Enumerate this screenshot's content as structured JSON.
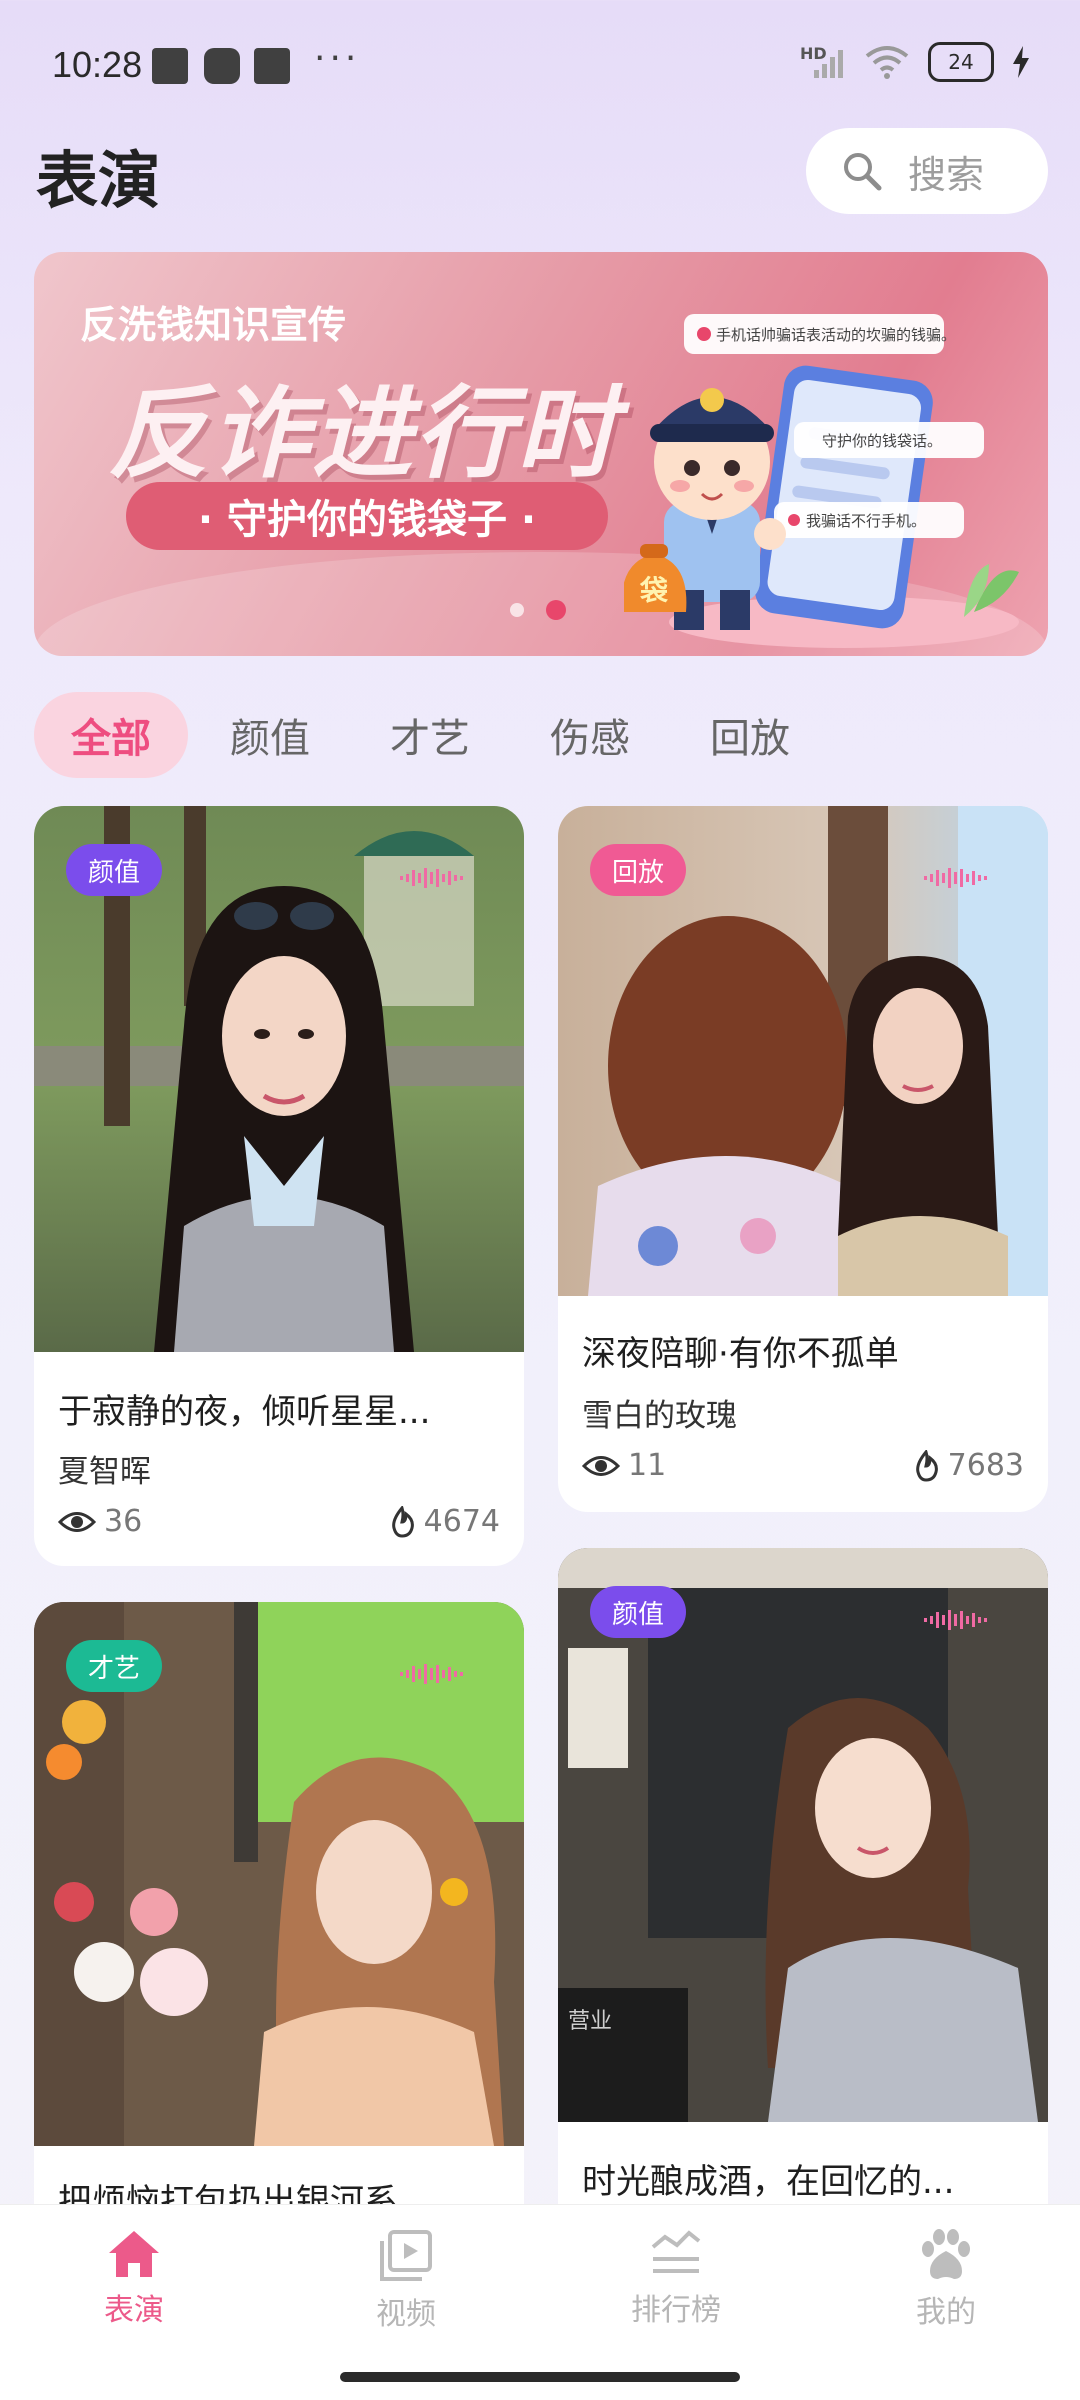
{
  "status_bar": {
    "time": "10:28",
    "dots": "···",
    "network": "HD",
    "battery": "24"
  },
  "header": {
    "title": "表演",
    "search_label": "搜索"
  },
  "banner": {
    "subtitle": "反洗钱知识宣传",
    "headline": "反诈进行时",
    "slogan": "· 守护你的钱袋子 ·",
    "bubbles": [
      "手机话帅骗话表活动的坎骗的钱骗。",
      "守护你的钱袋话。",
      "我骗话不行手机。"
    ],
    "bag_text": "袋",
    "page_index": 2,
    "page_count": 2
  },
  "tabs": [
    {
      "label": "全部",
      "active": true
    },
    {
      "label": "颜值",
      "active": false
    },
    {
      "label": "才艺",
      "active": false
    },
    {
      "label": "伤感",
      "active": false
    },
    {
      "label": "回放",
      "active": false
    }
  ],
  "cards": [
    {
      "badge": "颜值",
      "badge_color": "#7b4dec",
      "title": "于寂静的夜，倾听星星...",
      "author": "夏智晖",
      "views": "36",
      "heat": "4674"
    },
    {
      "badge": "回放",
      "badge_color": "#f05a94",
      "title": "深夜陪聊·有你不孤单",
      "author": "雪白的玫瑰",
      "views": "11",
      "heat": "7683"
    },
    {
      "badge": "才艺",
      "badge_color": "#1cba94",
      "title": "把烦恼打包扔出银河系",
      "author": "",
      "views": "",
      "heat": ""
    },
    {
      "badge": "颜值",
      "badge_color": "#7b4dec",
      "title": "时光酿成酒，在回忆的...",
      "author": "",
      "views": "",
      "heat": ""
    }
  ],
  "nav": [
    {
      "label": "表演",
      "icon": "home-icon",
      "active": true
    },
    {
      "label": "视频",
      "icon": "video-icon",
      "active": false
    },
    {
      "label": "排行榜",
      "icon": "ranking-icon",
      "active": false
    },
    {
      "label": "我的",
      "icon": "paw-icon",
      "active": false
    }
  ],
  "colors": {
    "accent": "#ec5a8a",
    "tab_active_bg": "#fad4e0",
    "inactive": "#b6b6b6"
  }
}
